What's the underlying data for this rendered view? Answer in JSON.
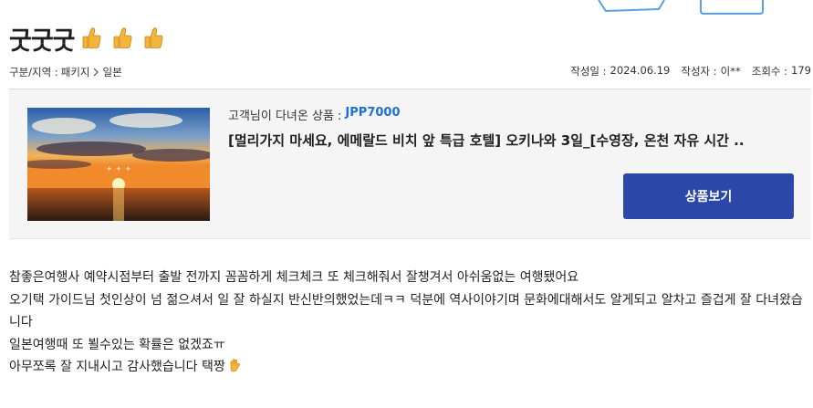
{
  "header": {
    "title": "굿굿굿",
    "thumb_icons": [
      "thumbs-up-icon",
      "thumbs-up-icon",
      "thumbs-up-icon"
    ]
  },
  "meta": {
    "breadcrumb": {
      "prefix": "구분/지역 : ",
      "level1": "패키지",
      "level2": "일본"
    },
    "date_label": "작성일 :",
    "date": "2024.06.19",
    "author_label": "작성자 :",
    "author": "이**",
    "views_label": "조회수 :",
    "views": "179"
  },
  "product": {
    "code_label": "고객님이 다녀온 상품 :",
    "code": "JPP7000",
    "name": "[멀리가지 마세요, 에메랄드 비치 앞 특급 호텔] 오키나와 3일_[수영장, 온천 자유 시간 ..",
    "view_button": "상품보기",
    "image_icon": "sunset-photo"
  },
  "review": {
    "lines": [
      "참좋은여행사 예약시점부터 출발 전까지 꼼꼼하게 체크체크 또 체크해줘서 잘챙겨서 아쉬움없는 여행됐어요",
      "오기택 가이드님 첫인상이 넘 젊으셔서 일 잘 하실지 반신반의했었는데ㅋㅋ 덕분에 역사이야기며 문화에대해서도 알게되고 알차고 즐겁게 잘 다녀왔습니다",
      "일본여행때 또 뵐수있는 확률은 없겠죠ㅠ",
      "아무쪼록 잘 지내시고 감사했습니다 택짱"
    ]
  },
  "colors": {
    "accent_blue": "#2b48a8",
    "code_blue": "#1e6fd9",
    "panel_bg": "#f5f5f6"
  }
}
